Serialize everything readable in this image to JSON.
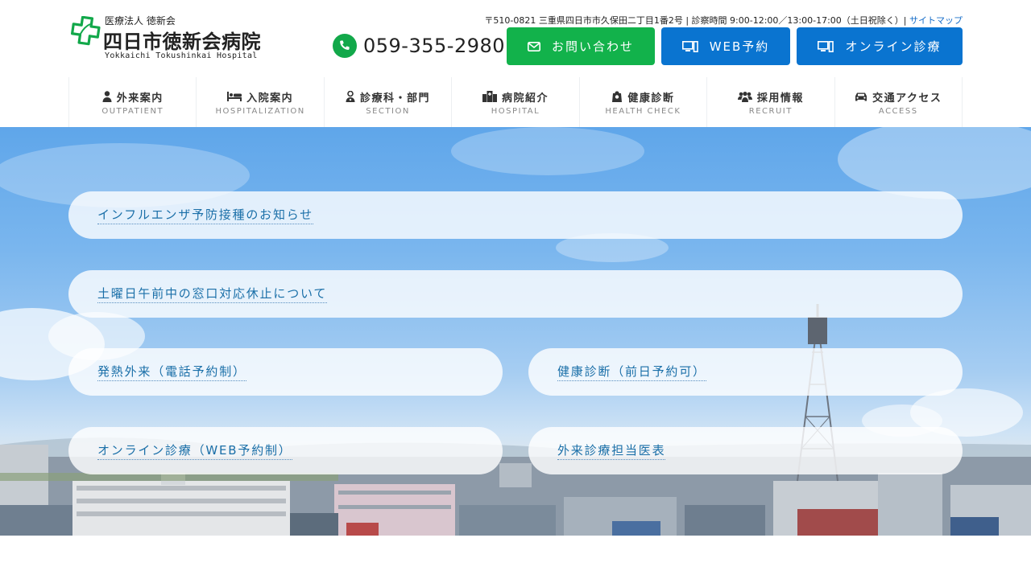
{
  "header": {
    "logo": {
      "corp": "医療法人 徳新会",
      "name": "四日市徳新会病院",
      "name_en": "Yokkaichi Tokushinkai Hospital",
      "mark_color": "#12a84a"
    },
    "info": {
      "address_hours": "〒510-0821 三重県四日市市久保田二丁目1番2号 | 診察時間 9:00-12:00／13:00-17:00（土日祝除く）|",
      "sitemap_label": "サイトマップ"
    },
    "phone": {
      "number": "059-355-2980",
      "icon": "phone-icon",
      "color": "#12a84a"
    },
    "buttons": {
      "contact": {
        "label": "お問い合わせ",
        "icon": "mail-icon",
        "color": "#12b24b"
      },
      "web": {
        "label": "WEB予約",
        "icon": "computer-icon",
        "color": "#0a74d0"
      },
      "online": {
        "label": "オンライン診療",
        "icon": "computer-icon",
        "color": "#0a74d0"
      }
    }
  },
  "nav": {
    "items": [
      {
        "label": "外来案内",
        "sub": "OUTPATIENT",
        "icon": "user-icon"
      },
      {
        "label": "入院案内",
        "sub": "HOSPITALIZATION",
        "icon": "bed-icon"
      },
      {
        "label": "診療科・部門",
        "sub": "SECTION",
        "icon": "doctor-icon"
      },
      {
        "label": "病院紹介",
        "sub": "HOSPITAL",
        "icon": "hospital-icon"
      },
      {
        "label": "健康診断",
        "sub": "HEALTH CHECK",
        "icon": "checkup-icon"
      },
      {
        "label": "採用情報",
        "sub": "RECRUIT",
        "icon": "users-icon"
      },
      {
        "label": "交通アクセス",
        "sub": "ACCESS",
        "icon": "car-icon"
      }
    ]
  },
  "hero": {
    "links": {
      "influenza": "インフルエンザ予防接種のお知らせ",
      "saturday": "土曜日午前中の窓口対応休止について",
      "fever": "発熱外来（電話予約制）",
      "checkup": "健康診断（前日予約可）",
      "online": "オンライン診療（WEB予約制）",
      "schedule": "外来診療担当医表"
    },
    "link_color": "#1a6fa8"
  }
}
